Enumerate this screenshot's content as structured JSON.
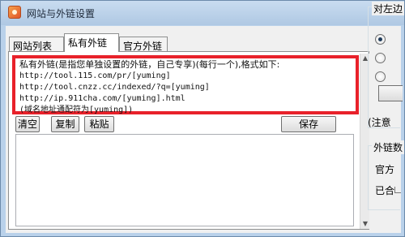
{
  "window": {
    "title": "网站与外链设置"
  },
  "tabs": [
    {
      "label": "网站列表"
    },
    {
      "label": "私有外链"
    },
    {
      "label": "官方外链"
    }
  ],
  "info": {
    "lines": [
      "私有外链(是指您单独设置的外链，自己专享)(每行一个),格式如下:",
      "http://tool.115.com/pr/[yuming]",
      "http://tool.cnzz.cc/indexed/?q=[yuming]",
      "http://ip.911cha.com/[yuming].html",
      "(域名地址通配符为[yuming])"
    ]
  },
  "buttons": {
    "clear": "清空",
    "copy": "复制",
    "paste": "粘贴",
    "save": "保存"
  },
  "textarea": {
    "value": ""
  },
  "side_panel": {
    "group_top_legend": "对左边",
    "radio_1": "",
    "radio_2": "",
    "radio_3": "",
    "note": "(注意",
    "group_bottom_legend": "外链数",
    "line_1": "官方",
    "line_2": "已合"
  }
}
